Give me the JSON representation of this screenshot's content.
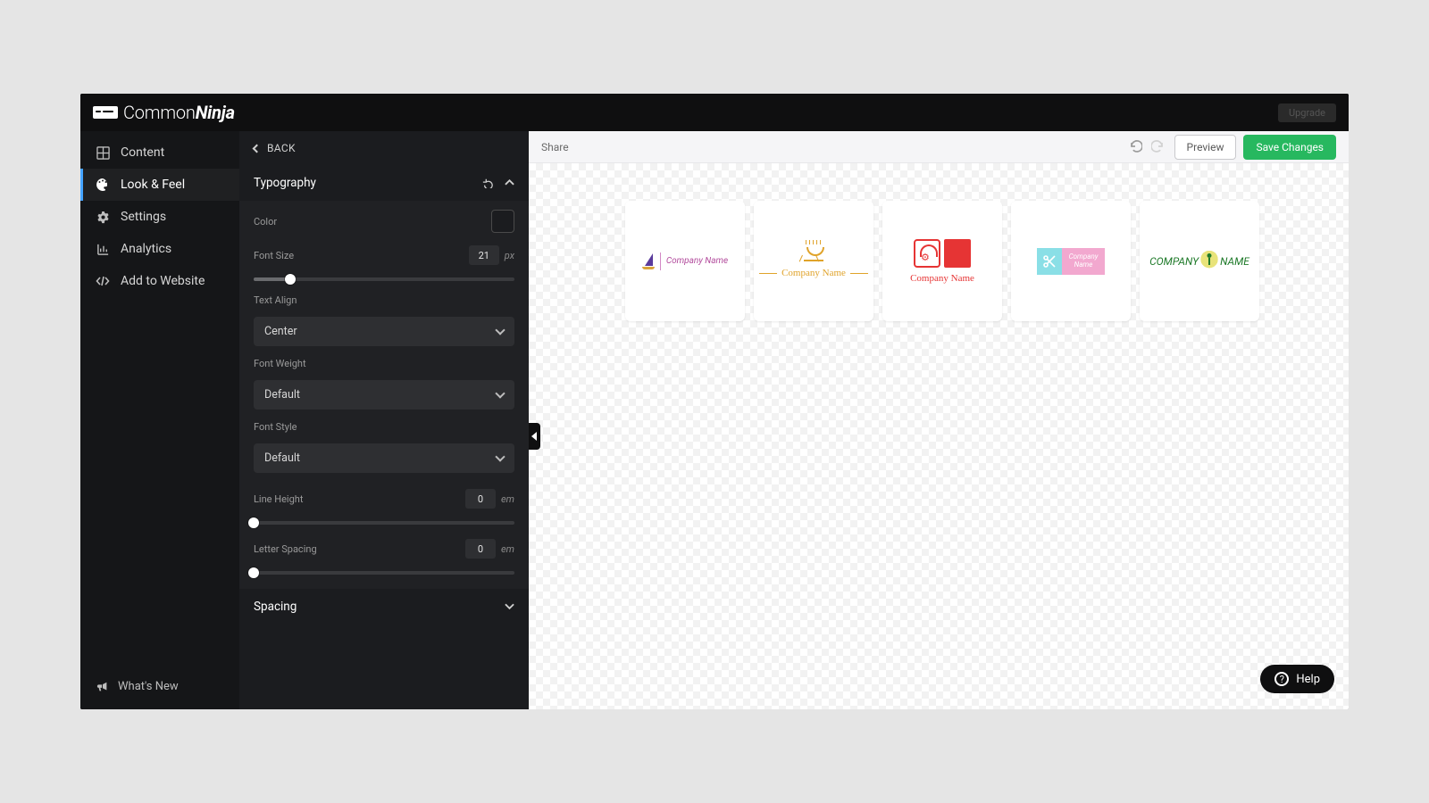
{
  "brand": {
    "name_thin": "Common",
    "name_bold": "Ninja"
  },
  "header": {
    "upgrade": "Upgrade"
  },
  "sidebar": {
    "items": [
      {
        "label": "Content"
      },
      {
        "label": "Look & Feel"
      },
      {
        "label": "Settings"
      },
      {
        "label": "Analytics"
      },
      {
        "label": "Add to Website"
      }
    ],
    "whats_new": "What's New"
  },
  "props": {
    "back": "BACK",
    "typography_title": "Typography",
    "spacing_title": "Spacing",
    "fields": {
      "color_label": "Color",
      "font_size_label": "Font Size",
      "font_size_value": "21",
      "font_size_unit": "px",
      "text_align_label": "Text Align",
      "text_align_value": "Center",
      "font_weight_label": "Font Weight",
      "font_weight_value": "Default",
      "font_style_label": "Font Style",
      "font_style_value": "Default",
      "line_height_label": "Line Height",
      "line_height_value": "0",
      "line_height_unit": "em",
      "letter_spacing_label": "Letter Spacing",
      "letter_spacing_value": "0",
      "letter_spacing_unit": "em"
    }
  },
  "toolbar": {
    "share": "Share",
    "preview": "Preview",
    "save": "Save Changes"
  },
  "canvas": {
    "cards": [
      {
        "text": "Company Name"
      },
      {
        "text": "Company Name"
      },
      {
        "text": "Company Name"
      },
      {
        "text_line1": "Company",
        "text_line2": "Name"
      },
      {
        "text_left": "COMPANY",
        "text_right": "NAME"
      }
    ]
  },
  "help": "Help"
}
